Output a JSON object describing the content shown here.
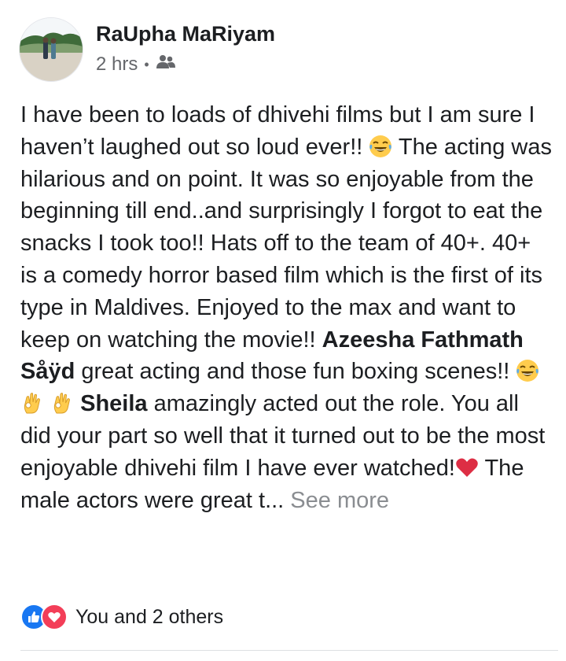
{
  "post": {
    "author": "RaUpha MaRiyam",
    "time": "2 hrs",
    "separator": "•",
    "audience_icon": "friends-icon",
    "segments": {
      "s1": "I have been to loads of dhivehi films but I am sure I haven’t laughed out so loud ever!! ",
      "s2": " The acting was hilarious and on point. It was so enjoyable from the beginning till end..and surprisingly I forgot to eat the snacks I took too!! Hats off to the team of 40+. 40+ is a comedy horror based film which is the first of its type in Maldives. Enjoyed to the max and want to keep on watching the movie!! ",
      "tag1": "Azeesha Fathmath Såÿd",
      "s3": " great acting and those fun boxing scenes!! ",
      "s4": " ",
      "tag2": "Sheila",
      "s5": " amazingly acted out the role. You all did your part so well that it turned out to be the most enjoyable dhivehi film I have ever watched!",
      "s6": " The male actors were great t...",
      "see_more": " See more"
    },
    "emojis": [
      "laughing-tears-emoji",
      "laughing-tears-emoji",
      "ok-hand-emoji",
      "ok-hand-emoji",
      "red-heart-emoji"
    ]
  },
  "reactions": {
    "icons": [
      "like-reaction-icon",
      "love-reaction-icon"
    ],
    "text": "You and 2 others",
    "colors": {
      "like": "#1877f2",
      "love": "#f33e58"
    }
  }
}
